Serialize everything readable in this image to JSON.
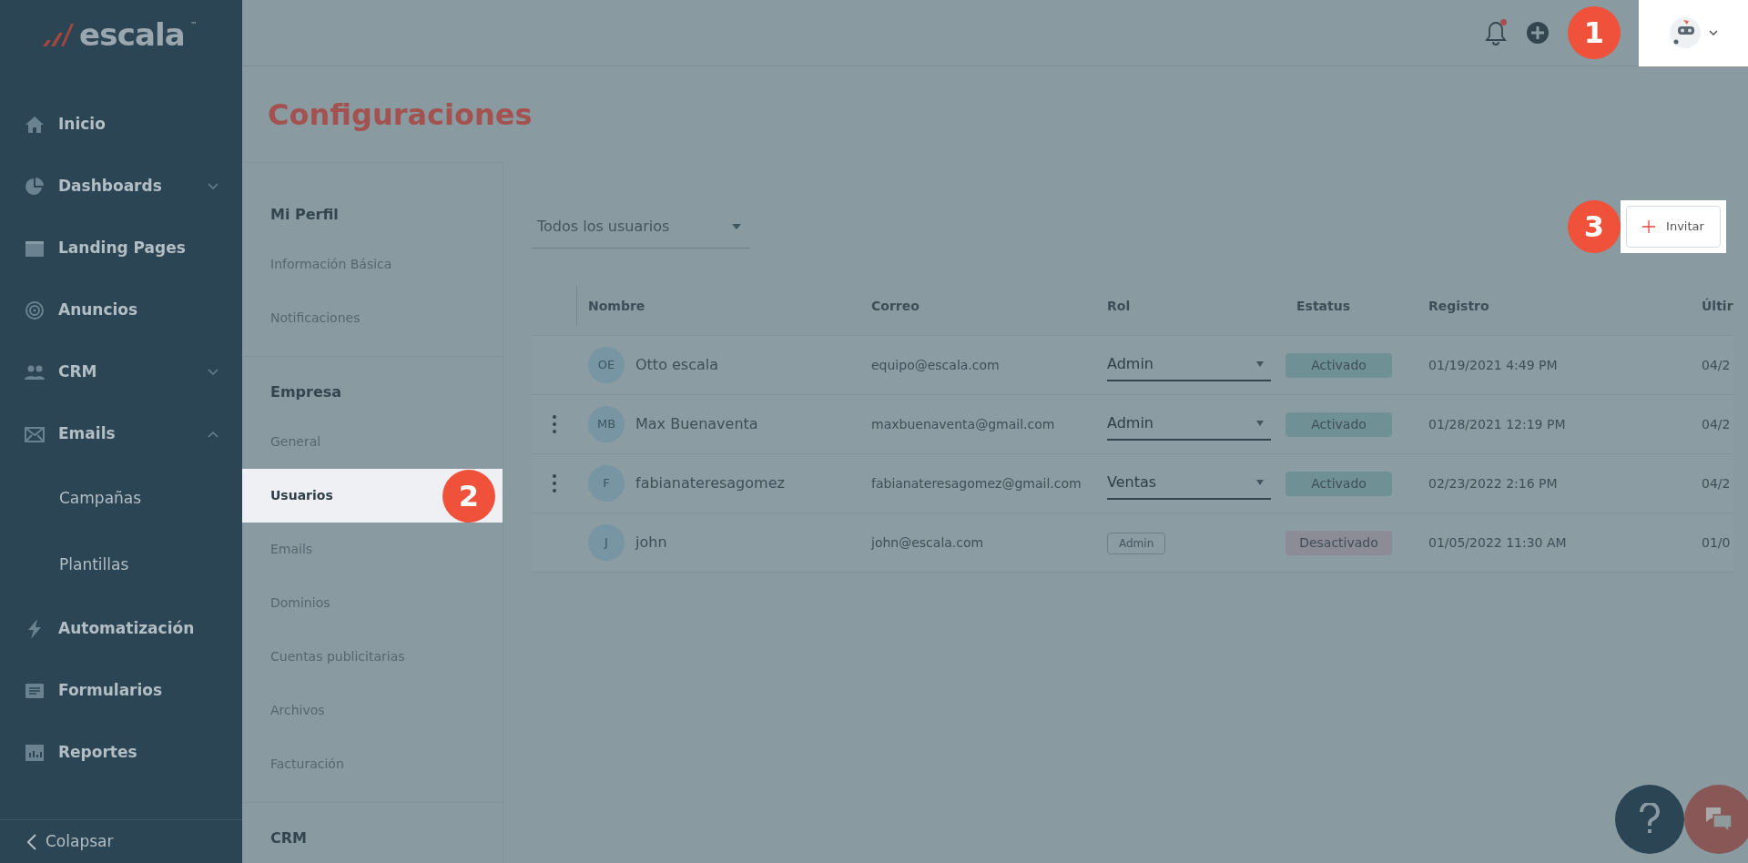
{
  "sidebar": {
    "logo": "escala",
    "logo_mark": "™",
    "items": [
      {
        "label": "Inicio",
        "expandable": false
      },
      {
        "label": "Dashboards",
        "expandable": true,
        "expanded": false
      },
      {
        "label": "Landing Pages",
        "expandable": false
      },
      {
        "label": "Anuncios",
        "expandable": false
      },
      {
        "label": "CRM",
        "expandable": true,
        "expanded": false
      },
      {
        "label": "Emails",
        "expandable": true,
        "expanded": true,
        "children": [
          {
            "label": "Campañas"
          },
          {
            "label": "Plantillas"
          }
        ]
      },
      {
        "label": "Automatización",
        "expandable": false
      },
      {
        "label": "Formularios",
        "expandable": false
      },
      {
        "label": "Reportes",
        "expandable": false
      }
    ],
    "collapse": "Colapsar"
  },
  "header": {
    "notification_dot": true,
    "user_menu": {
      "spotlight": true,
      "callout": "1"
    }
  },
  "page_title": "Configuraciones",
  "settings_nav": [
    {
      "title": "Mi Perfil",
      "items": [
        {
          "label": "Información Básica",
          "selected": false
        },
        {
          "label": "Notificaciones",
          "selected": false
        }
      ]
    },
    {
      "title": "Empresa",
      "items": [
        {
          "label": "General",
          "selected": false
        },
        {
          "label": "Usuarios",
          "selected": true,
          "spotlight": true,
          "callout": "2"
        },
        {
          "label": "Emails",
          "selected": false
        },
        {
          "label": "Dominios",
          "selected": false
        },
        {
          "label": "Cuentas publicitarias",
          "selected": false
        },
        {
          "label": "Archivos",
          "selected": false
        },
        {
          "label": "Facturación",
          "selected": false
        }
      ]
    },
    {
      "title": "CRM"
    }
  ],
  "filter": {
    "value": "Todos los usuarios"
  },
  "invite_button": {
    "label": "Invitar",
    "spotlight": true,
    "callout": "3"
  },
  "table": {
    "columns": [
      "Nombre",
      "Correo",
      "Rol",
      "Estatus",
      "Registro",
      "Últir"
    ],
    "rows": [
      {
        "has_menu": false,
        "initials": "OE",
        "name": "Otto escala",
        "email": "equipo@escala.com",
        "role": {
          "kind": "select",
          "label": "Admin"
        },
        "status": {
          "label": "Activado",
          "active": true
        },
        "registered": "01/19/2021 4:49 PM",
        "last": "04/2"
      },
      {
        "has_menu": true,
        "initials": "MB",
        "name": "Max Buenaventa",
        "email": "maxbuenaventa@gmail.com",
        "role": {
          "kind": "select",
          "label": "Admin"
        },
        "status": {
          "label": "Activado",
          "active": true
        },
        "registered": "01/28/2021 12:19 PM",
        "last": "04/2"
      },
      {
        "has_menu": true,
        "initials": "F",
        "name": "fabianateresagomez",
        "email": "fabianateresagomez@gmail.com",
        "role": {
          "kind": "select",
          "label": "Ventas"
        },
        "status": {
          "label": "Activado",
          "active": true
        },
        "registered": "02/23/2022 2:16 PM",
        "last": "04/2"
      },
      {
        "has_menu": false,
        "initials": "J",
        "name": "john",
        "email": "john@escala.com",
        "role": {
          "kind": "tag",
          "label": "Admin"
        },
        "status": {
          "label": "Desactivado",
          "active": false
        },
        "registered": "01/05/2022 11:30 AM",
        "last": "01/0"
      }
    ]
  }
}
